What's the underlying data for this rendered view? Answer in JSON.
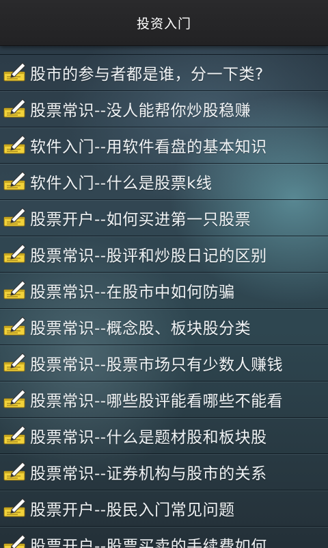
{
  "header": {
    "title": "投资入门"
  },
  "articles": [
    {
      "label": "股市的参与者都是谁，分一下类?",
      "icon": "notepad-pencil-icon"
    },
    {
      "label": "股票常识--没人能帮你炒股稳赚",
      "icon": "notepad-pencil-icon"
    },
    {
      "label": "软件入门--用软件看盘的基本知识",
      "icon": "notepad-pencil-icon"
    },
    {
      "label": "软件入门--什么是股票k线",
      "icon": "notepad-pencil-icon"
    },
    {
      "label": "股票开户--如何买进第一只股票",
      "icon": "notepad-pencil-icon"
    },
    {
      "label": "股票常识--股评和炒股日记的区别",
      "icon": "notepad-pencil-icon"
    },
    {
      "label": "股票常识--在股市中如何防骗",
      "icon": "notepad-pencil-icon"
    },
    {
      "label": "股票常识--概念股、板块股分类",
      "icon": "notepad-pencil-icon"
    },
    {
      "label": "股票常识--股票市场只有少数人赚钱",
      "icon": "notepad-pencil-icon"
    },
    {
      "label": "股票常识--哪些股评能看哪些不能看",
      "icon": "notepad-pencil-icon"
    },
    {
      "label": "股票常识--什么是题材股和板块股",
      "icon": "notepad-pencil-icon"
    },
    {
      "label": "股票常识--证券机构与股市的关系",
      "icon": "notepad-pencil-icon"
    },
    {
      "label": "股票开户--股民入门常见问题",
      "icon": "notepad-pencil-icon"
    },
    {
      "label": "股票开户--股票买卖的手续费如何",
      "icon": "notepad-pencil-icon"
    }
  ],
  "colors": {
    "title_bar": "#222224",
    "text": "#f0f3f5",
    "icon_pad": "#f2d23a",
    "icon_pencil": "#ffffff"
  }
}
